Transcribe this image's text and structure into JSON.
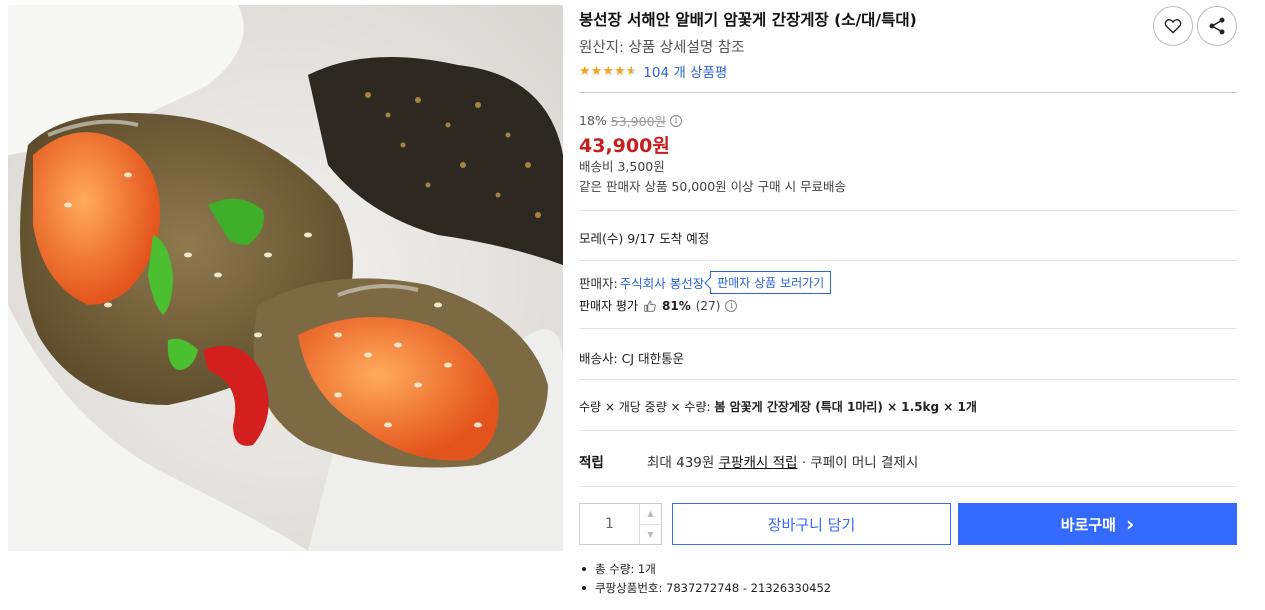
{
  "product": {
    "title": "봉선장 서해안 알배기 암꽃게 간장게장 (소/대/특대)",
    "origin": "원산지: 상품 상세설명 참조",
    "rating_stars": 4.5,
    "review_count_text": "104 개 상품평",
    "image_icon": "crab-food-photo"
  },
  "price": {
    "discount_rate": "18%",
    "original_price": "53,900원",
    "info_icon": "i",
    "sale_price": "43,900원",
    "shipping_fee": "배송비 3,500원",
    "free_shipping_note": "같은 판매자 상품 50,000원 이상 구매 시 무료배송"
  },
  "delivery": {
    "arrival": "모레(수) 9/17 도착 예정",
    "carrier": "배송사:  CJ 대한통운"
  },
  "seller": {
    "label": "판매자:",
    "name": "주식회사 봉선장",
    "more_button": "판매자 상품 보러가기",
    "rating_label": "판매자 평가",
    "rating_pct": "81%",
    "rating_count": "(27)"
  },
  "option": {
    "prefix": "수량 × 개당 중량 × 수량: ",
    "value": "봄 암꽃게 간장게장 (특대 1마리) × 1.5kg × 1개"
  },
  "reward": {
    "label": "적립",
    "amount": "최대 439원 ",
    "link": "쿠팡캐시 적립",
    "suffix": " · 쿠페이 머니 결제시"
  },
  "purchase": {
    "quantity": "1",
    "cart_button": "장바구니 담기",
    "buy_button": "바로구매",
    "buy_arrow": "›"
  },
  "details": [
    "총 수량: 1개",
    "쿠팡상품번호: 7837272748 - 21326330452"
  ],
  "colors": {
    "accent": "#346aff",
    "sale": "#c81d1d",
    "link": "#2b64d6",
    "star": "#f2a31b"
  }
}
